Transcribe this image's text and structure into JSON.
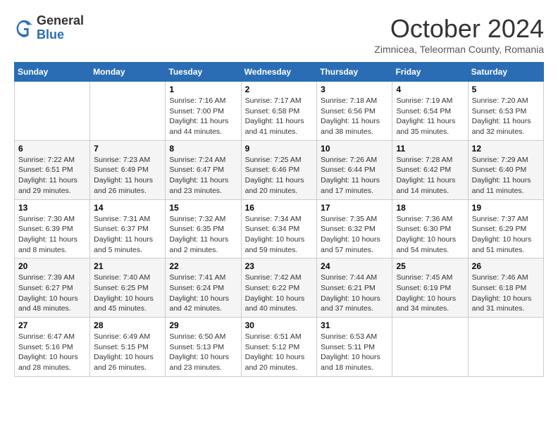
{
  "header": {
    "logo_general": "General",
    "logo_blue": "Blue",
    "month_title": "October 2024",
    "subtitle": "Zimnicea, Teleorman County, Romania"
  },
  "days_of_week": [
    "Sunday",
    "Monday",
    "Tuesday",
    "Wednesday",
    "Thursday",
    "Friday",
    "Saturday"
  ],
  "weeks": [
    [
      {
        "day": "",
        "info": ""
      },
      {
        "day": "",
        "info": ""
      },
      {
        "day": "1",
        "info": "Sunrise: 7:16 AM\nSunset: 7:00 PM\nDaylight: 11 hours and 44 minutes."
      },
      {
        "day": "2",
        "info": "Sunrise: 7:17 AM\nSunset: 6:58 PM\nDaylight: 11 hours and 41 minutes."
      },
      {
        "day": "3",
        "info": "Sunrise: 7:18 AM\nSunset: 6:56 PM\nDaylight: 11 hours and 38 minutes."
      },
      {
        "day": "4",
        "info": "Sunrise: 7:19 AM\nSunset: 6:54 PM\nDaylight: 11 hours and 35 minutes."
      },
      {
        "day": "5",
        "info": "Sunrise: 7:20 AM\nSunset: 6:53 PM\nDaylight: 11 hours and 32 minutes."
      }
    ],
    [
      {
        "day": "6",
        "info": "Sunrise: 7:22 AM\nSunset: 6:51 PM\nDaylight: 11 hours and 29 minutes."
      },
      {
        "day": "7",
        "info": "Sunrise: 7:23 AM\nSunset: 6:49 PM\nDaylight: 11 hours and 26 minutes."
      },
      {
        "day": "8",
        "info": "Sunrise: 7:24 AM\nSunset: 6:47 PM\nDaylight: 11 hours and 23 minutes."
      },
      {
        "day": "9",
        "info": "Sunrise: 7:25 AM\nSunset: 6:46 PM\nDaylight: 11 hours and 20 minutes."
      },
      {
        "day": "10",
        "info": "Sunrise: 7:26 AM\nSunset: 6:44 PM\nDaylight: 11 hours and 17 minutes."
      },
      {
        "day": "11",
        "info": "Sunrise: 7:28 AM\nSunset: 6:42 PM\nDaylight: 11 hours and 14 minutes."
      },
      {
        "day": "12",
        "info": "Sunrise: 7:29 AM\nSunset: 6:40 PM\nDaylight: 11 hours and 11 minutes."
      }
    ],
    [
      {
        "day": "13",
        "info": "Sunrise: 7:30 AM\nSunset: 6:39 PM\nDaylight: 11 hours and 8 minutes."
      },
      {
        "day": "14",
        "info": "Sunrise: 7:31 AM\nSunset: 6:37 PM\nDaylight: 11 hours and 5 minutes."
      },
      {
        "day": "15",
        "info": "Sunrise: 7:32 AM\nSunset: 6:35 PM\nDaylight: 11 hours and 2 minutes."
      },
      {
        "day": "16",
        "info": "Sunrise: 7:34 AM\nSunset: 6:34 PM\nDaylight: 10 hours and 59 minutes."
      },
      {
        "day": "17",
        "info": "Sunrise: 7:35 AM\nSunset: 6:32 PM\nDaylight: 10 hours and 57 minutes."
      },
      {
        "day": "18",
        "info": "Sunrise: 7:36 AM\nSunset: 6:30 PM\nDaylight: 10 hours and 54 minutes."
      },
      {
        "day": "19",
        "info": "Sunrise: 7:37 AM\nSunset: 6:29 PM\nDaylight: 10 hours and 51 minutes."
      }
    ],
    [
      {
        "day": "20",
        "info": "Sunrise: 7:39 AM\nSunset: 6:27 PM\nDaylight: 10 hours and 48 minutes."
      },
      {
        "day": "21",
        "info": "Sunrise: 7:40 AM\nSunset: 6:25 PM\nDaylight: 10 hours and 45 minutes."
      },
      {
        "day": "22",
        "info": "Sunrise: 7:41 AM\nSunset: 6:24 PM\nDaylight: 10 hours and 42 minutes."
      },
      {
        "day": "23",
        "info": "Sunrise: 7:42 AM\nSunset: 6:22 PM\nDaylight: 10 hours and 40 minutes."
      },
      {
        "day": "24",
        "info": "Sunrise: 7:44 AM\nSunset: 6:21 PM\nDaylight: 10 hours and 37 minutes."
      },
      {
        "day": "25",
        "info": "Sunrise: 7:45 AM\nSunset: 6:19 PM\nDaylight: 10 hours and 34 minutes."
      },
      {
        "day": "26",
        "info": "Sunrise: 7:46 AM\nSunset: 6:18 PM\nDaylight: 10 hours and 31 minutes."
      }
    ],
    [
      {
        "day": "27",
        "info": "Sunrise: 6:47 AM\nSunset: 5:16 PM\nDaylight: 10 hours and 28 minutes."
      },
      {
        "day": "28",
        "info": "Sunrise: 6:49 AM\nSunset: 5:15 PM\nDaylight: 10 hours and 26 minutes."
      },
      {
        "day": "29",
        "info": "Sunrise: 6:50 AM\nSunset: 5:13 PM\nDaylight: 10 hours and 23 minutes."
      },
      {
        "day": "30",
        "info": "Sunrise: 6:51 AM\nSunset: 5:12 PM\nDaylight: 10 hours and 20 minutes."
      },
      {
        "day": "31",
        "info": "Sunrise: 6:53 AM\nSunset: 5:11 PM\nDaylight: 10 hours and 18 minutes."
      },
      {
        "day": "",
        "info": ""
      },
      {
        "day": "",
        "info": ""
      }
    ]
  ]
}
